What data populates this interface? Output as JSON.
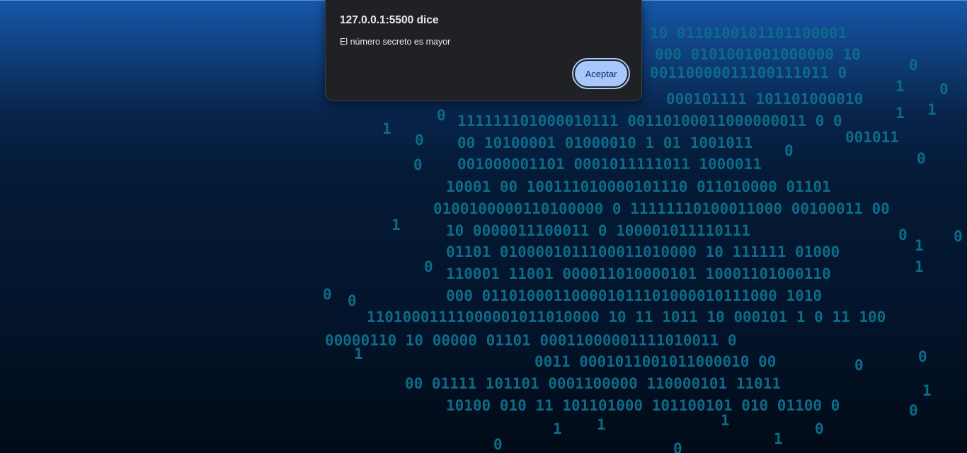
{
  "dialog": {
    "title": "127.0.0.1:5500 dice",
    "message": "El número secreto es mayor",
    "accept_label": "Aceptar"
  },
  "background": {
    "colors": {
      "top": "#1657a8",
      "bottom": "#020b17",
      "digits": "#0d6b88"
    },
    "binary_rows": [
      "10 0110100101101100001",
      "000 0101001001000000 10",
      "00110000011100111011 0",
      "000101111 101101000010",
      "111111101000010111 00110100011000000011 0 0",
      "00 10100001 01000010 1 01 1001011",
      "001000001101 0001011111011 1000011",
      "10001 00 100111010000101110 011010000 01101",
      "0100100000110100000 0 11111110100011000 00100011 00",
      "10 0000011100011 0 100001011110111",
      "01101 0100001011100011010000 10 111111 01000",
      "110001 11001 000011010000101 10001101000110",
      "000 011010001100001011101000010111000 1010",
      "11010001111000001011010000 10 11 1011 10 000101 1 0 11 100",
      "00000110 10 00000 01101 00011000001111010011 0",
      "0011 0001011001011000010 00",
      "00 01111 101101 0001100000 110000101 11011",
      "10100 010 11 101101000 101100101 010 01100 0"
    ]
  }
}
